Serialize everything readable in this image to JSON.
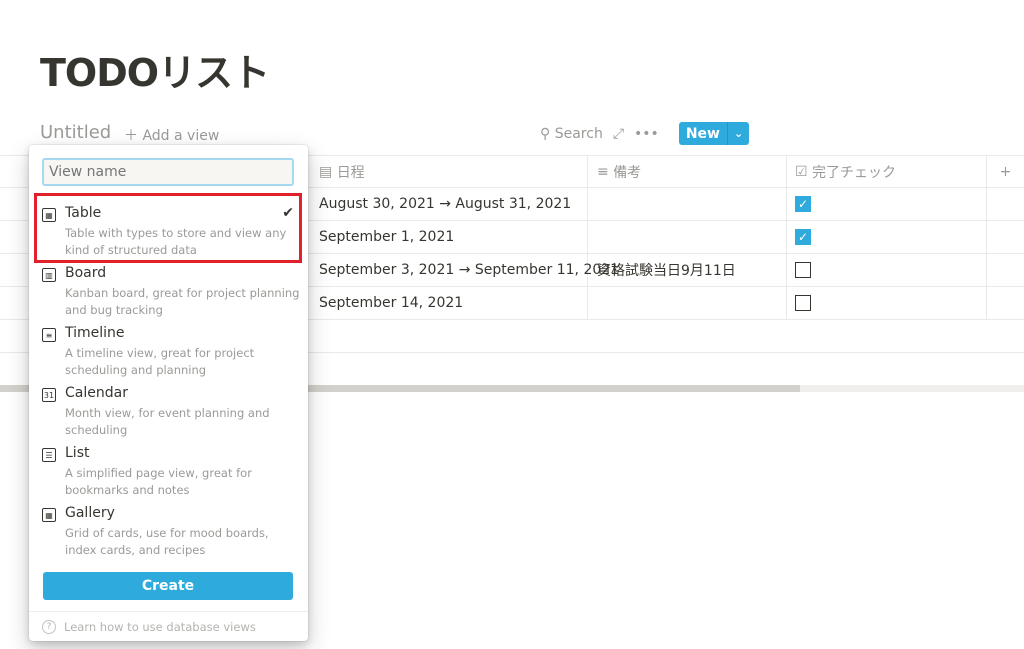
{
  "page": {
    "title": "TODOリスト"
  },
  "view": {
    "name": "Untitled",
    "add_view": "Add a view"
  },
  "toolbar": {
    "search": "Search",
    "new": "New"
  },
  "table": {
    "columns": [
      {
        "label": "日程",
        "icon": "calendar-icon"
      },
      {
        "label": "備考",
        "icon": "text-icon"
      },
      {
        "label": "完了チェック",
        "icon": "checkbox-icon"
      }
    ],
    "rows": [
      {
        "date": "August 30, 2021 → August 31, 2021",
        "note": "",
        "done": true
      },
      {
        "date": "September 1, 2021",
        "note": "",
        "done": true
      },
      {
        "date": "September 3, 2021 → September 11, 2021",
        "note": "資格試験当日9月11日",
        "done": false
      },
      {
        "date": "September 14, 2021",
        "note": "",
        "done": false
      }
    ]
  },
  "popup": {
    "placeholder": "View name",
    "options": [
      {
        "name": "Table",
        "desc": "Table with types to store and view any kind of structured data",
        "icon": "table-icon",
        "selected": true
      },
      {
        "name": "Board",
        "desc": "Kanban board, great for project planning and bug tracking",
        "icon": "board-icon"
      },
      {
        "name": "Timeline",
        "desc": "A timeline view, great for project scheduling and planning",
        "icon": "timeline-icon"
      },
      {
        "name": "Calendar",
        "desc": "Month view, for event planning and scheduling",
        "icon": "calendar-icon"
      },
      {
        "name": "List",
        "desc": "A simplified page view, great for bookmarks and notes",
        "icon": "list-icon"
      },
      {
        "name": "Gallery",
        "desc": "Grid of cards, use for mood boards, index cards, and recipes",
        "icon": "gallery-icon"
      }
    ],
    "create": "Create",
    "help": "Learn how to use database views"
  },
  "colors": {
    "accent": "#2eaadc",
    "highlight": "#e0202a"
  }
}
